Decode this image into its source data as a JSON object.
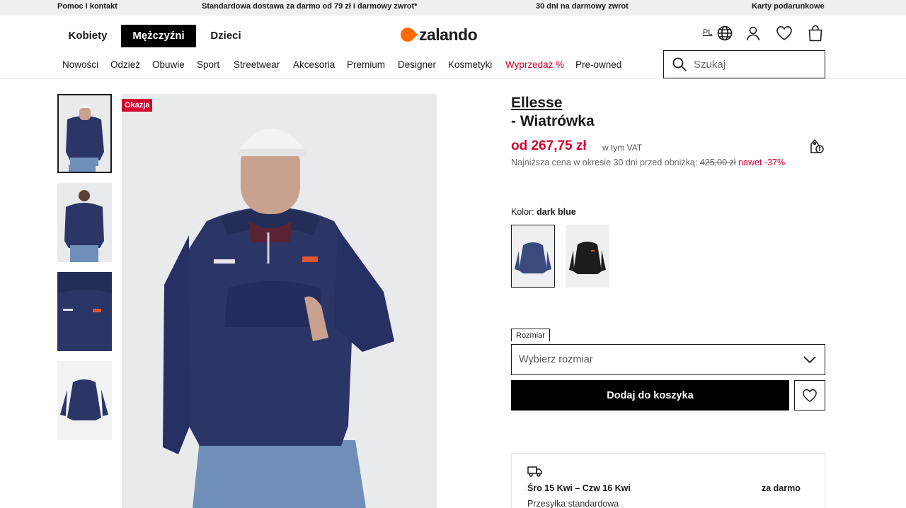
{
  "topbar": {
    "help": "Pomoc i kontakt",
    "shipping": "Standardowa dostawa za darmo od 79 zł i darmowy zwrot*",
    "returns": "30 dni na darmowy zwrot",
    "giftcards": "Karty podarunkowe"
  },
  "header": {
    "genders": [
      "Kobiety",
      "Mężczyźni",
      "Dzieci"
    ],
    "logo_text": "zalando",
    "lang": "PL",
    "search_placeholder": "Szukaj"
  },
  "nav": [
    "Nowości",
    "Odzież",
    "Obuwie",
    "Sport",
    "Streetwear",
    "Akcesoria",
    "Premium",
    "Designer",
    "Kosmetyki",
    "Wyprzedaż %",
    "Pre-owned"
  ],
  "product": {
    "badge": "Okazja",
    "brand": "Ellesse",
    "name": "- Wiatrówka",
    "price": "od 267,75 zł",
    "vat": "w tym VAT",
    "lowest_text": "Najniższa cena w okresie 30 dni przed obniżką:",
    "lowest_price": "425,00 zł",
    "discount": "nawet -37%",
    "color_label": "Kolor:",
    "color_value": "dark blue",
    "size_label": "Rozmiar",
    "size_placeholder": "Wybierz rozmiar",
    "cart_button": "Dodaj do koszyka"
  },
  "delivery": {
    "dates": "Śro 15 Kwi – Czw 16 Kwi",
    "price": "za darmo",
    "type": "Przesyłka standardowa"
  },
  "colors": {
    "accent_red": "#d1002f",
    "brand_orange": "#ff6900",
    "jacket_navy": "#2b3566"
  }
}
